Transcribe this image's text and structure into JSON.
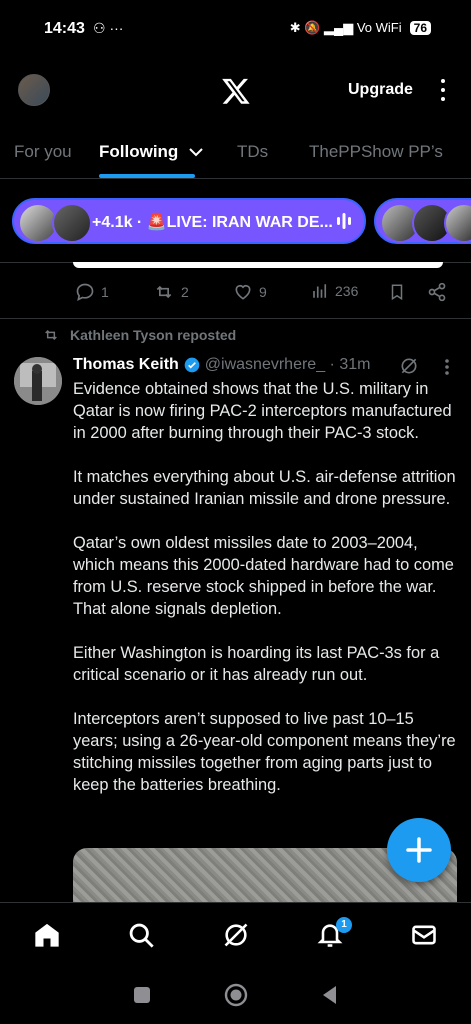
{
  "status_bar": {
    "time": "14:43",
    "left_icons": "⚇ ···",
    "right_icons": "✱ 🔕 ▂▄▆ Vo WiFi",
    "battery": "76"
  },
  "header": {
    "upgrade_label": "Upgrade"
  },
  "tabs": [
    {
      "label": "For you"
    },
    {
      "label": "Following"
    },
    {
      "label": "TDs"
    },
    {
      "label": "ThePPShow PP’s"
    }
  ],
  "live": {
    "text": "+4.1k · 🚨LIVE: IRAN WAR DE..."
  },
  "prev_tweet_actions": {
    "replies": "1",
    "reposts": "2",
    "likes": "9",
    "views": "236"
  },
  "tweet": {
    "repost_by": "Kathleen Tyson reposted",
    "author_name": "Thomas Keith",
    "author_handle": "@iwasnevrhere_ · 31m",
    "paragraphs": [
      "Evidence obtained shows that the U.S. military in Qatar is now firing PAC-2 interceptors manufactured in 2000 after burning through their PAC-3 stock.",
      "It matches everything about U.S. air-defense attrition under sustained Iranian missile and drone pressure.",
      "Qatar’s own oldest missiles date to 2003–2004, which means this 2000-dated hardware had to come from U.S. reserve stock shipped in before the war. That alone signals depletion.",
      "Either Washington is hoarding its last PAC-3s for a critical scenario or it has already run out.",
      "Interceptors aren’t supposed to live past 10–15 years; using a 26-year-old component means they’re stitching missiles together from aging parts just to keep the batteries breathing."
    ]
  },
  "bottom_nav": {
    "notifications_badge": "1"
  },
  "colors": {
    "accent": "#1d9bf0",
    "live_pill": "#7856ff",
    "muted": "#71767b"
  }
}
